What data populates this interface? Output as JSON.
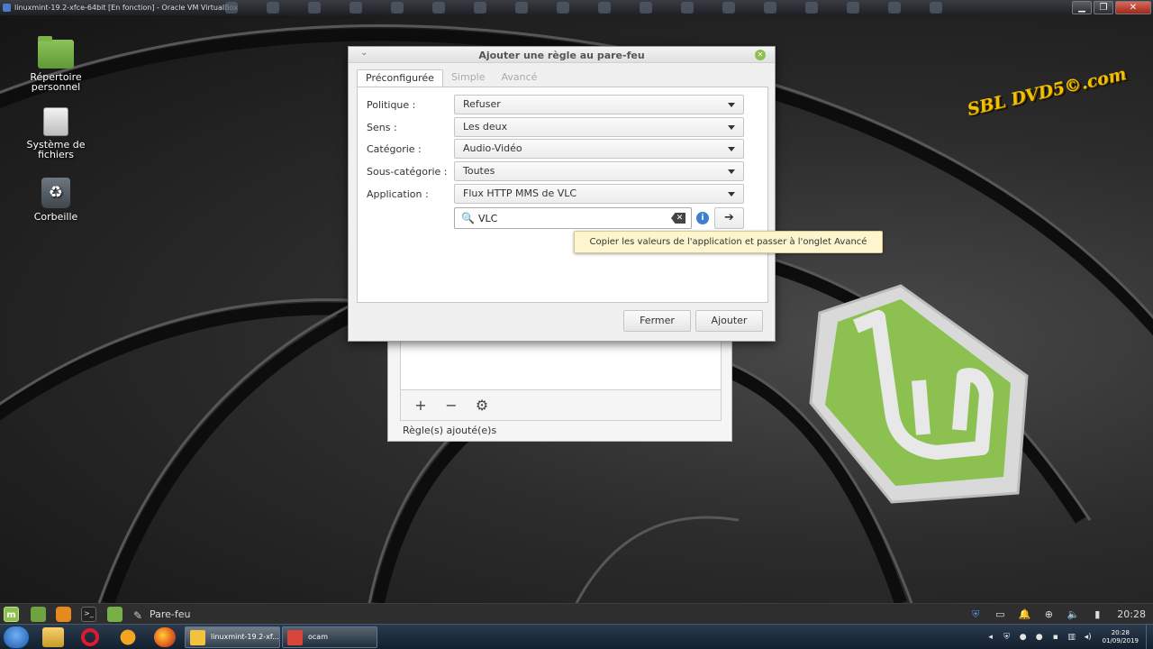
{
  "host": {
    "title": "linuxmint-19.2-xfce-64bit [En fonction] - Oracle VM VirtualBox",
    "controls": {
      "minimize": "▁",
      "maximize": "❐",
      "close": "✕"
    },
    "taskbar": {
      "tasks": [
        {
          "label": "linuxmint-19.2-xf..."
        },
        {
          "label": "ocam"
        }
      ],
      "clock_time": "20:28",
      "clock_date": "01/09/2019"
    }
  },
  "desktop": {
    "icons": [
      {
        "label": "Répertoire personnel",
        "icon": "folder-icon"
      },
      {
        "label": "Système de fichiers",
        "icon": "drive-icon"
      },
      {
        "label": "Corbeille",
        "icon": "trash-icon"
      }
    ],
    "watermark": "SBL DVD5©.com"
  },
  "dialog": {
    "title": "Ajouter une règle au pare-feu",
    "tabs": [
      {
        "label": "Préconfigurée",
        "active": true
      },
      {
        "label": "Simple",
        "active": false
      },
      {
        "label": "Avancé",
        "active": false
      }
    ],
    "fields": {
      "politique": {
        "label": "Politique :",
        "value": "Refuser"
      },
      "sens": {
        "label": "Sens :",
        "value": "Les deux"
      },
      "categorie": {
        "label": "Catégorie :",
        "value": "Audio-Vidéo"
      },
      "sous_categorie": {
        "label": "Sous-catégorie :",
        "value": "Toutes"
      },
      "application": {
        "label": "Application :",
        "value": "Flux HTTP MMS de VLC"
      }
    },
    "search": {
      "value": "VLC"
    },
    "info_glyph": "i",
    "tooltip": "Copier les valeurs de l'application et passer à l'onglet Avancé",
    "buttons": {
      "close": "Fermer",
      "add": "Ajouter"
    }
  },
  "firewall_window": {
    "status": "Règle(s) ajouté(e)s",
    "toolbar": {
      "add": "+",
      "remove": "−",
      "settings": "⚙"
    }
  },
  "guest_panel": {
    "task_label": "Pare-feu",
    "clock": "20:28"
  },
  "colors": {
    "mint_green": "#8cc152",
    "tooltip_bg": "#fdf5ce",
    "info_blue": "#3f7fd2"
  }
}
